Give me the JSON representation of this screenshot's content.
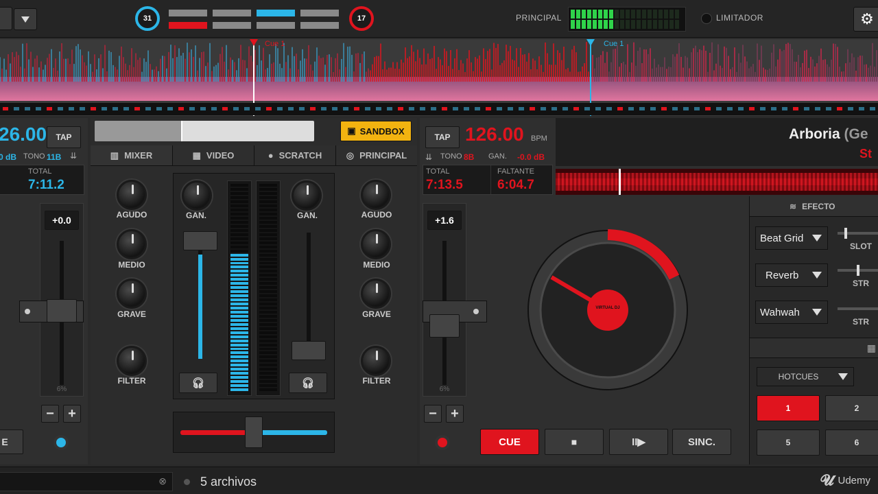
{
  "topbar": {
    "left_counter": "31",
    "right_counter": "17",
    "principal_label": "PRINCIPAL",
    "limiter_label": "LIMITADOR",
    "vu_active_segments": 8,
    "vu_total_segments": 20
  },
  "waveform": {
    "cue_left_label": "Cue 1",
    "cue_right_label": "Cue 1"
  },
  "deck_left": {
    "bpm": "26.00",
    "tap_label": "TAP",
    "gain_value": "0 dB",
    "tono_label": "TONO",
    "key": "11B",
    "total_label": "TOTAL",
    "total_time": "7:11.2",
    "pitch_value": "+0.0",
    "pitch_range": "6%",
    "minus": "−",
    "plus": "+",
    "cue_button_partial": "E"
  },
  "mixer": {
    "sandbox_label": "SANDBOX",
    "tabs": [
      "MIXER",
      "VIDEO",
      "SCRATCH",
      "PRINCIPAL"
    ],
    "left_eq": [
      "AGUDO",
      "MEDIO",
      "GRAVE",
      "FILTER"
    ],
    "right_eq": [
      "AGUDO",
      "MEDIO",
      "GRAVE",
      "FILTER"
    ],
    "gain_left": "GAN.",
    "gain_right": "GAN."
  },
  "deck_right": {
    "tap_label": "TAP",
    "bpm": "126.00",
    "bpm_unit": "BPM",
    "tono_label": "TONO",
    "key": "8B",
    "gan_label": "GAN.",
    "gan_value": "-0.0 dB",
    "total_label": "TOTAL",
    "total_time": "7:13.5",
    "remaining_label": "FALTANTE",
    "remaining_time": "6:04.7",
    "pitch_value": "+1.6",
    "pitch_range": "6%",
    "minus": "−",
    "plus": "+",
    "title": "Arboria",
    "title_extra": "(Ge",
    "artist_partial": "St",
    "platter_logo": "VIRTUAL DJ",
    "transport": {
      "cue": "CUE",
      "stop": "■",
      "play": "II▶",
      "sync": "SINC."
    }
  },
  "effects": {
    "header": "EFECTO",
    "slots": [
      {
        "name": "Beat Grid",
        "param": "SLOT"
      },
      {
        "name": "Reverb",
        "param": "STR"
      },
      {
        "name": "Wahwah",
        "param": "STR"
      }
    ]
  },
  "hotcues": {
    "selector": "HOTCUES",
    "pads": [
      "1",
      "2",
      "5",
      "6"
    ]
  },
  "browser": {
    "file_count": "5 archivos"
  },
  "watermark": "Udemy",
  "colors": {
    "accent_blue": "#2cb6e8",
    "accent_red": "#e0141e",
    "vu_green": "#2fd34a"
  }
}
